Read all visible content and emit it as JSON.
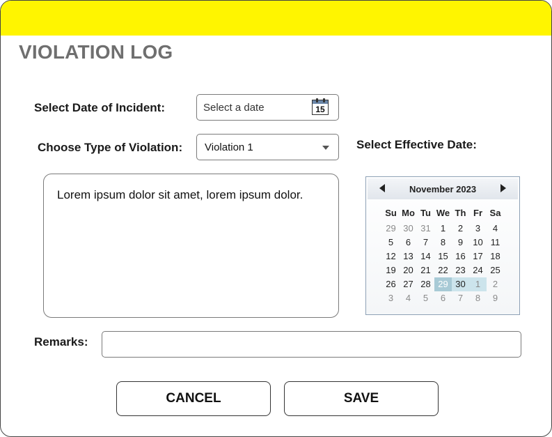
{
  "header": {
    "title": "VIOLATION LOG",
    "bar_color": "#FFF500"
  },
  "form": {
    "incident_date_label": "Select Date of Incident:",
    "incident_date_placeholder": "Select a date",
    "calendar_icon_day": "15",
    "violation_type_label": "Choose Type of Violation:",
    "violation_type_value": "Violation 1",
    "description_text": "Lorem ipsum dolor sit amet, lorem ipsum dolor.",
    "effective_date_label": "Select Effective Date:",
    "remarks_label": "Remarks:",
    "remarks_value": ""
  },
  "calendar": {
    "month_label": "November 2023",
    "day_names": [
      "Su",
      "Mo",
      "Tu",
      "We",
      "Th",
      "Fr",
      "Sa"
    ],
    "weeks": [
      [
        {
          "d": "29",
          "o": true
        },
        {
          "d": "30",
          "o": true
        },
        {
          "d": "31",
          "o": true
        },
        {
          "d": "1"
        },
        {
          "d": "2"
        },
        {
          "d": "3"
        },
        {
          "d": "4"
        }
      ],
      [
        {
          "d": "5"
        },
        {
          "d": "6"
        },
        {
          "d": "7"
        },
        {
          "d": "8"
        },
        {
          "d": "9"
        },
        {
          "d": "10"
        },
        {
          "d": "11"
        }
      ],
      [
        {
          "d": "12"
        },
        {
          "d": "13"
        },
        {
          "d": "14"
        },
        {
          "d": "15"
        },
        {
          "d": "16"
        },
        {
          "d": "17"
        },
        {
          "d": "18"
        }
      ],
      [
        {
          "d": "19"
        },
        {
          "d": "20"
        },
        {
          "d": "21"
        },
        {
          "d": "22"
        },
        {
          "d": "23"
        },
        {
          "d": "24"
        },
        {
          "d": "25"
        }
      ],
      [
        {
          "d": "26"
        },
        {
          "d": "27"
        },
        {
          "d": "28"
        },
        {
          "d": "29",
          "today": true
        },
        {
          "d": "30",
          "hl": true
        },
        {
          "d": "1",
          "o": true,
          "hl": true
        },
        {
          "d": "2",
          "o": true
        }
      ],
      [
        {
          "d": "3",
          "o": true
        },
        {
          "d": "4",
          "o": true
        },
        {
          "d": "5",
          "o": true
        },
        {
          "d": "6",
          "o": true
        },
        {
          "d": "7",
          "o": true
        },
        {
          "d": "8",
          "o": true
        },
        {
          "d": "9",
          "o": true
        }
      ]
    ]
  },
  "buttons": {
    "cancel_label": "CANCEL",
    "save_label": "SAVE"
  }
}
